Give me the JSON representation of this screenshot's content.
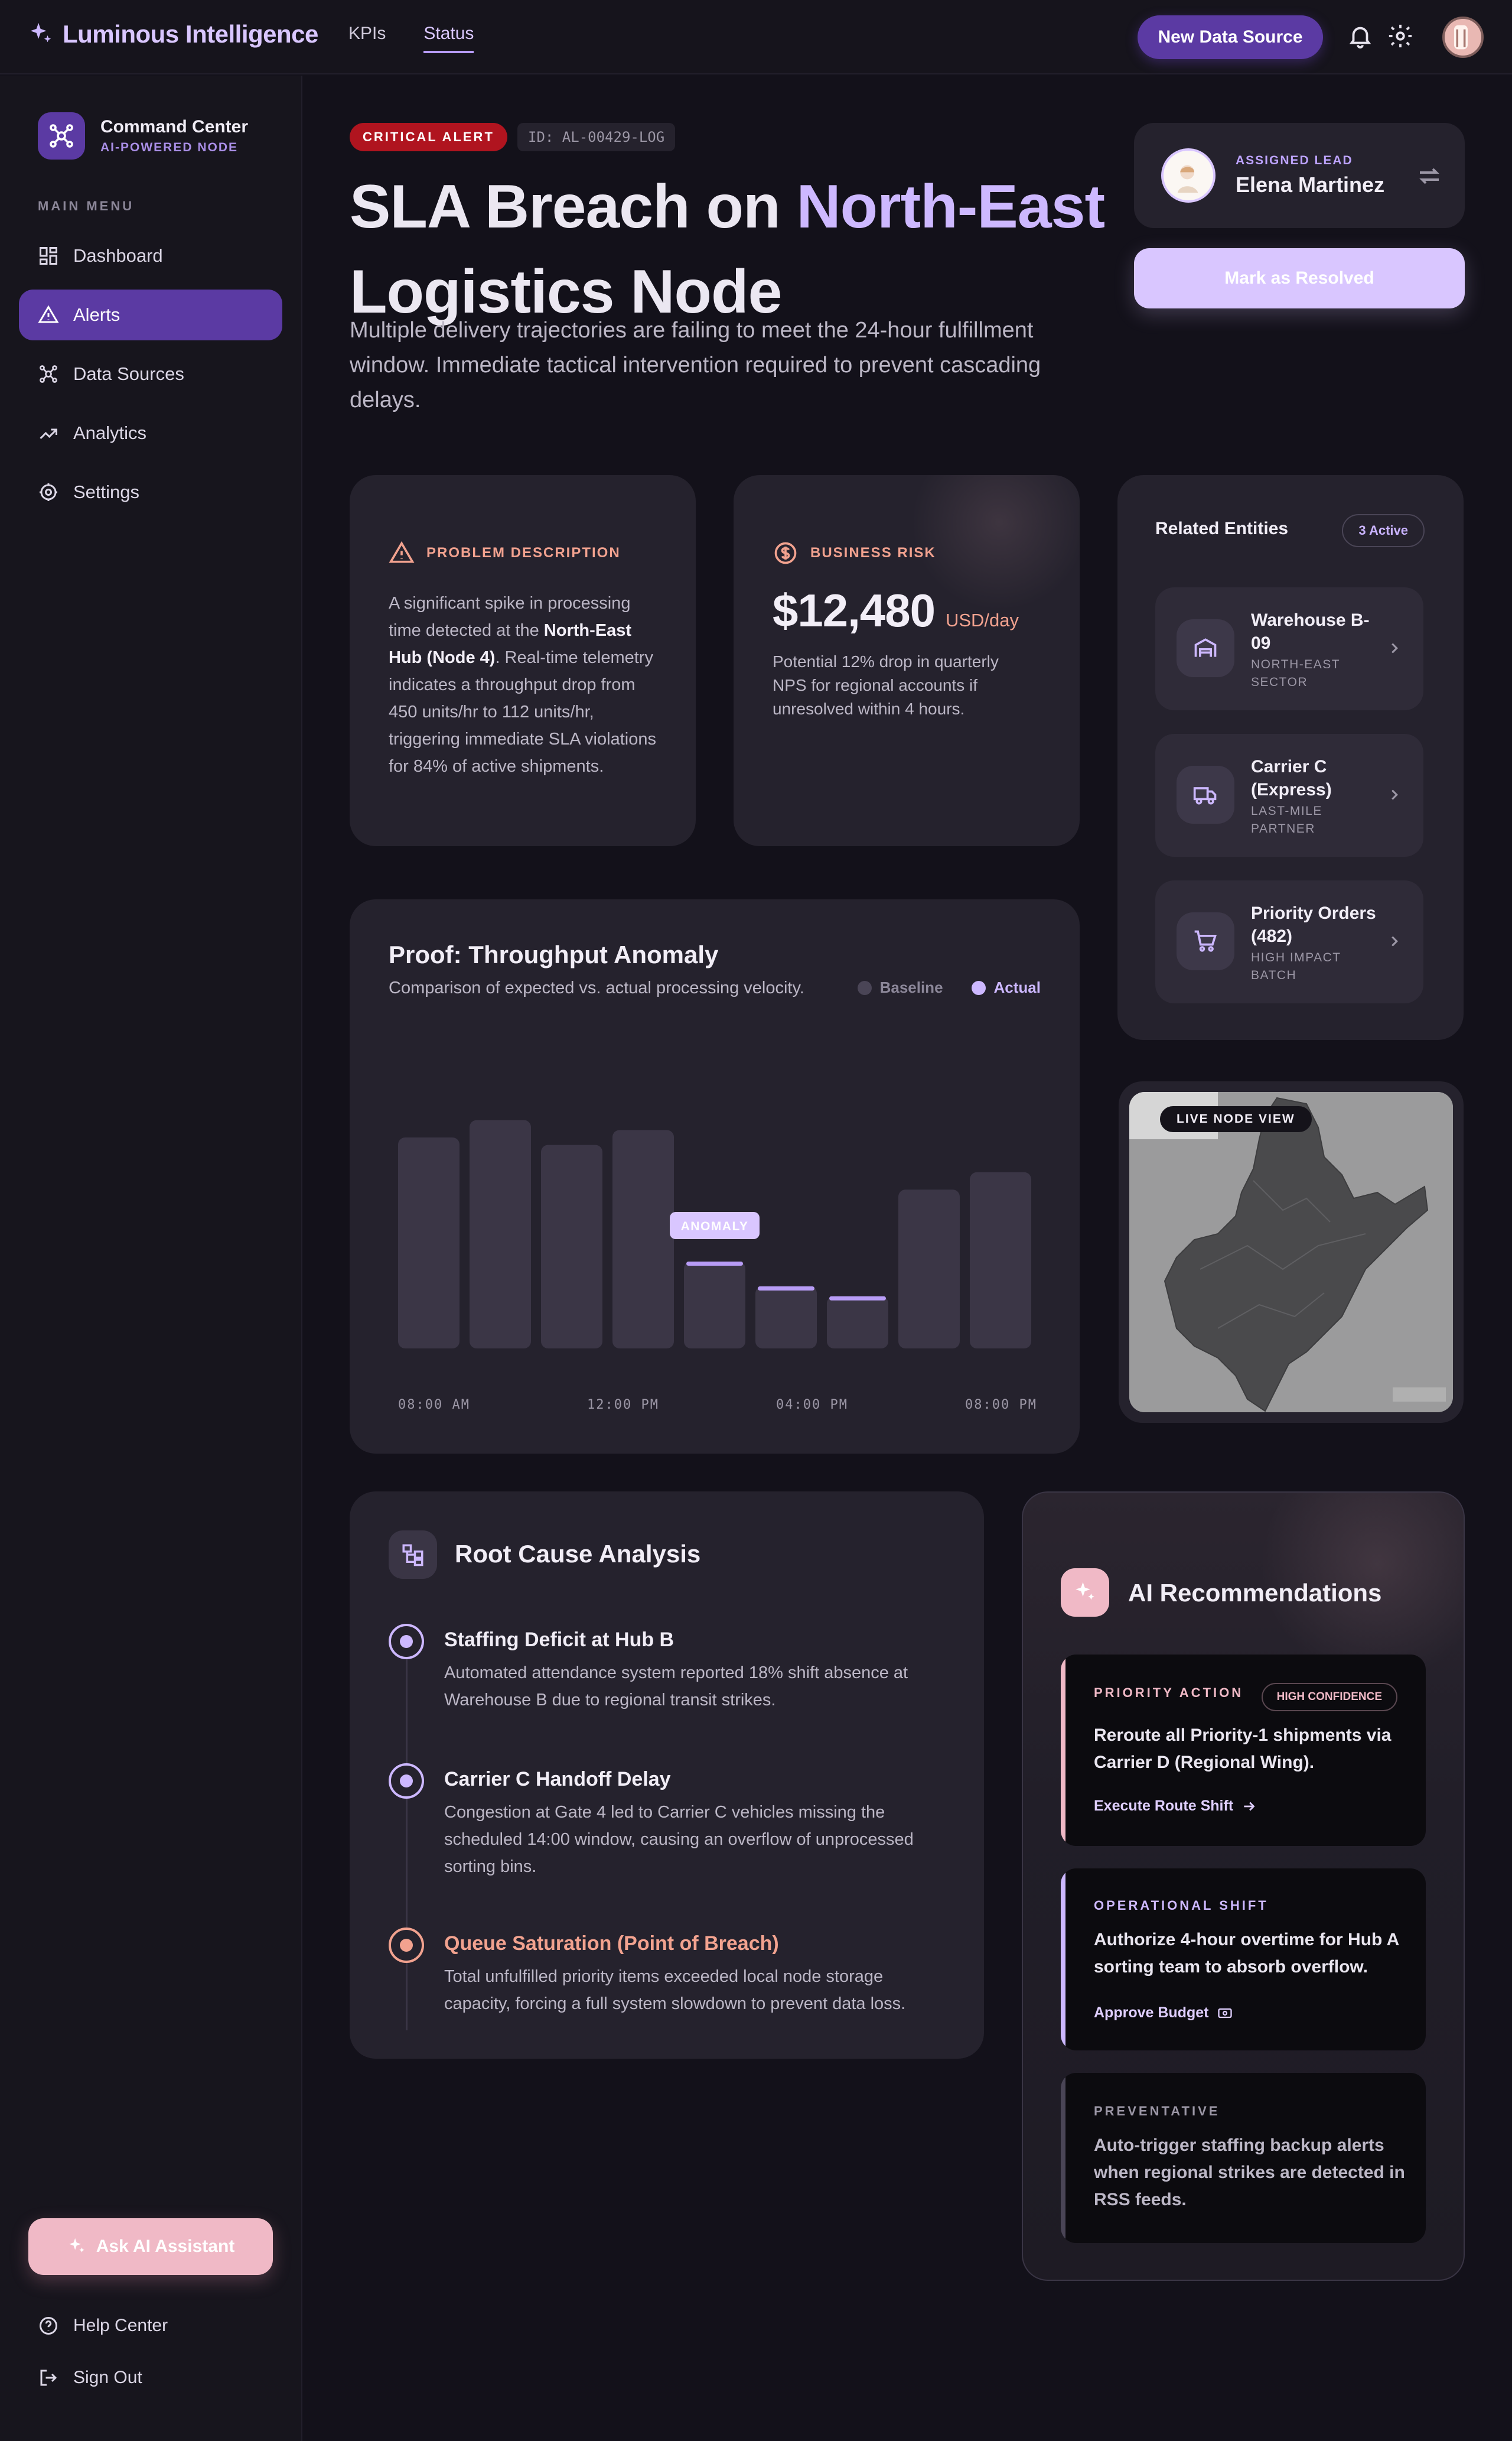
{
  "app": {
    "brand": "Luminous Intelligence"
  },
  "nav": {
    "tabs": [
      {
        "label": "KPIs"
      },
      {
        "label": "Status"
      }
    ]
  },
  "topbar": {
    "new_source_label": "New Data Source"
  },
  "sidebar": {
    "node_title": "Command Center",
    "node_subtitle": "AI-POWERED NODE",
    "menu_heading": "MAIN MENU",
    "items": [
      {
        "label": "Dashboard",
        "icon": "grid-icon"
      },
      {
        "label": "Alerts",
        "icon": "warning-icon"
      },
      {
        "label": "Data Sources",
        "icon": "hub-icon"
      },
      {
        "label": "Analytics",
        "icon": "trend-icon"
      },
      {
        "label": "Settings",
        "icon": "gear-icon"
      }
    ],
    "ask_label": "Ask AI Assistant",
    "help_label": "Help Center",
    "signout_label": "Sign Out"
  },
  "alert": {
    "badge": "CRITICAL ALERT",
    "id": "ID: AL-00429-LOG",
    "title_prefix": "SLA Breach on ",
    "title_accent": "North-East",
    "title_suffix": "Logistics Node",
    "description": "Multiple delivery trajectories are failing to meet the 24-hour fulfillment window. Immediate tactical intervention required to prevent cascading delays."
  },
  "lead": {
    "label": "ASSIGNED LEAD",
    "name": "Elena Martinez",
    "resolve_label": "Mark as Resolved"
  },
  "problem": {
    "heading": "PROBLEM DESCRIPTION",
    "text_1": "A significant spike in processing time detected at the ",
    "text_bold": "North-East Hub (Node 4)",
    "text_2": ". Real-time telemetry indicates a throughput drop from 450 units/hr to 112 units/hr, triggering immediate SLA violations for 84% of active shipments."
  },
  "risk": {
    "heading": "BUSINESS RISK",
    "amount": "$12,480",
    "unit": "USD/day",
    "text": "Potential 12% drop in quarterly NPS for regional accounts if unresolved within 4 hours."
  },
  "entities": {
    "title": "Related Entities",
    "badge": "3 Active",
    "items": [
      {
        "name": "Warehouse B-09",
        "sub": "NORTH-EAST SECTOR",
        "icon": "warehouse-icon"
      },
      {
        "name": "Carrier C (Express)",
        "sub": "LAST-MILE PARTNER",
        "icon": "truck-icon"
      },
      {
        "name": "Priority Orders (482)",
        "sub": "HIGH IMPACT BATCH",
        "icon": "cart-icon"
      }
    ]
  },
  "chart": {
    "title": "Proof: Throughput Anomaly",
    "subtitle": "Comparison of expected vs. actual processing velocity.",
    "anomaly_label": "ANOMALY"
  },
  "chart_data": {
    "type": "bar",
    "title": "Proof: Throughput Anomaly",
    "legend": [
      "Baseline",
      "Actual"
    ],
    "x_tick_labels": [
      "08:00 AM",
      "12:00 PM",
      "04:00 PM",
      "08:00 PM"
    ],
    "values": [
      0.85,
      0.92,
      0.82,
      0.88,
      0.35,
      0.25,
      0.21,
      0.64,
      0.71
    ],
    "highlighted": [
      false,
      false,
      false,
      false,
      true,
      true,
      true,
      false,
      false
    ],
    "anomaly_index": 4,
    "ylim": [
      0,
      1
    ],
    "grid": false,
    "legend_position": "top-right",
    "colors": {
      "bar": "#3b3646",
      "highlight_cap": "#b89cf6",
      "baseline_dot": "#4a4556",
      "actual_dot": "#cdb8ff"
    }
  },
  "map": {
    "label": "LIVE NODE VIEW"
  },
  "root_cause": {
    "title": "Root Cause Analysis",
    "items": [
      {
        "title": "Staffing Deficit at Hub B",
        "text": "Automated attendance system reported 18% shift absence at Warehouse B due to regional transit strikes."
      },
      {
        "title": "Carrier C Handoff Delay",
        "text": "Congestion at Gate 4 led to Carrier C vehicles missing the scheduled 14:00 window, causing an overflow of unprocessed sorting bins."
      },
      {
        "title": "Queue Saturation (Point of Breach)",
        "text": "Total unfulfilled priority items exceeded local node storage capacity, forcing a full system slowdown to prevent data loss."
      }
    ]
  },
  "recommendations": {
    "title": "AI Recommendations",
    "items": [
      {
        "kicker": "PRIORITY ACTION",
        "badge": "HIGH CONFIDENCE",
        "text": "Reroute all Priority-1 shipments via Carrier D (Regional Wing).",
        "action": "Execute Route Shift"
      },
      {
        "kicker": "OPERATIONAL SHIFT",
        "text": "Authorize 4-hour overtime for Hub A sorting team to absorb overflow.",
        "action": "Approve Budget"
      },
      {
        "kicker": "PREVENTATIVE",
        "text": "Auto-trigger staffing backup alerts when regional strikes are detected in RSS feeds."
      }
    ]
  },
  "colors": {
    "accent": "#5b3aa3",
    "accent_light": "#cdb8ff",
    "alert": "#b0141f",
    "coral": "#f2a28f",
    "pink": "#f0b9c6"
  }
}
